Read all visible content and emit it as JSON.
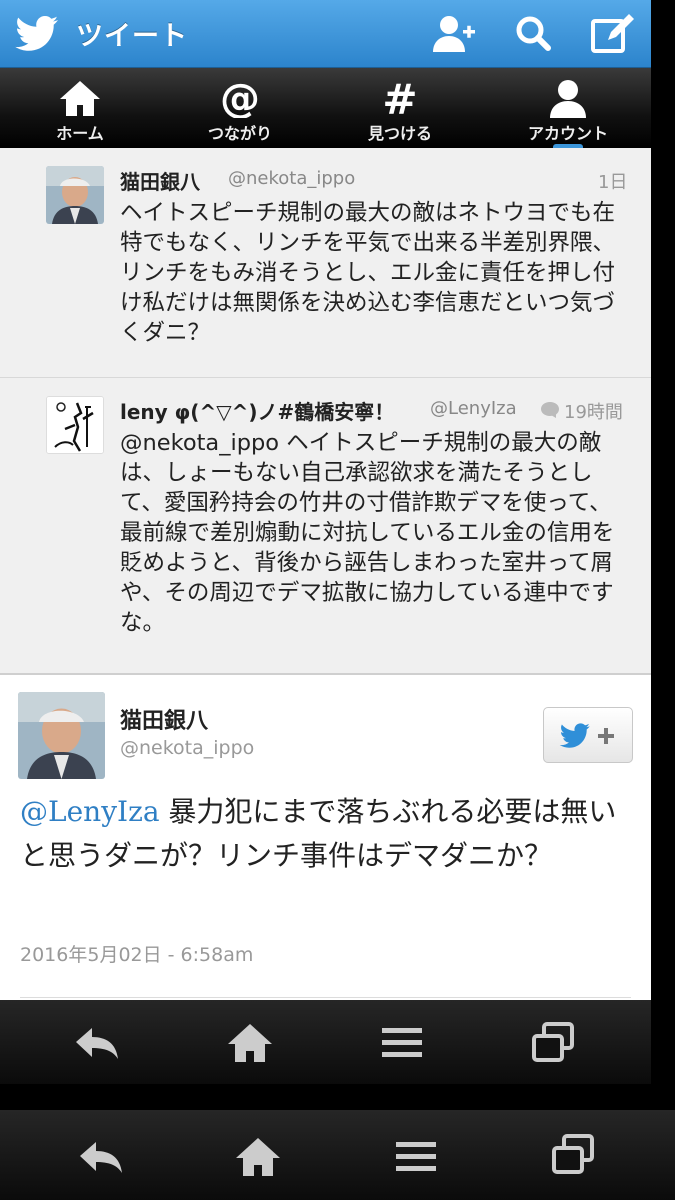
{
  "app": {
    "title": "ツイート"
  },
  "tabs": [
    {
      "label": "ホーム",
      "icon": "home-icon"
    },
    {
      "label": "つながり",
      "icon": "at-icon"
    },
    {
      "label": "見つける",
      "icon": "hash-icon"
    },
    {
      "label": "アカウント",
      "icon": "person-icon"
    }
  ],
  "timeline": [
    {
      "name": "猫田銀八",
      "handle": "@nekota_ippo",
      "time": "1日",
      "text": "ヘイトスピーチ規制の最大の敵はネトウヨでも在特でもなく、リンチを平気で出来る半差別界隈、リンチをもみ消そうとし、エル金に責任を押し付け私だけは無関係を決め込む李信恵だといつ気づくダニ？"
    },
    {
      "name": "leny φ(^▽^)ノ#鶴橋安寧！",
      "handle": "@LenyIza",
      "time": "19時間",
      "text": "@nekota_ippo ヘイトスピーチ規制の最大の敵は、しょーもない自己承認欲求を満たそうとして、愛国矜持会の竹井の寸借詐欺デマを使って、最前線で差別煽動に対抗しているエル金の信用を貶めようと、背後から誣告しまわった室井って屑や、その周辺でデマ拡散に協力している連中ですな。"
    }
  ],
  "detail": {
    "name": "猫田銀八",
    "handle": "@nekota_ippo",
    "mention": "@LenyIza",
    "text": " 暴力犯にまで落ちぶれる必要は無いと思うダニが？リンチ事件はデマダニか？",
    "date": "2016年5月02日 - 6:58am"
  },
  "colors": {
    "topbar": "#3a92d8",
    "mention": "#2f7fc4"
  }
}
